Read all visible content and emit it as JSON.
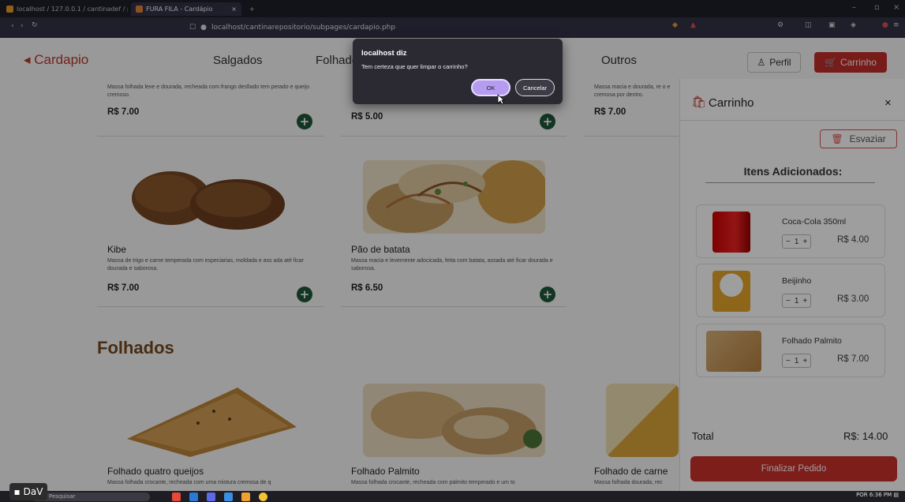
{
  "browser": {
    "tabs": [
      {
        "label": "localhost / 127.0.0.1 / cantinadef / p"
      },
      {
        "label": "FURA FILA - Cardápio"
      }
    ],
    "new_tab": "+",
    "url": "localhost/cantinarepositorio/subpages/cardapio.php"
  },
  "nav": {
    "brand": "Cardapio",
    "links": [
      "Salgados",
      "Folhados",
      "Outros"
    ],
    "perfil": "Perfil",
    "carrinho": "Carrinho"
  },
  "products_top": [
    {
      "desc": "Massa folhada leve e dourada, recheada com frango desfiado tem perado e queijo cremoso.",
      "price": "R$ 7.00"
    },
    {
      "desc": "",
      "price": "R$ 5.00"
    },
    {
      "desc": "Massa macia e dourada, re o e cremosa por dentro.",
      "price": "R$ 7.00"
    }
  ],
  "products_mid": [
    {
      "name": "Kibe",
      "desc": "Massa de trigo e carne temperada com especiarias, moldada e ass ada até ficar dourada e saborosa.",
      "price": "R$ 7.00"
    },
    {
      "name": "Pão de batata",
      "desc": "Massa macia e levemente adocicada, feita com batata, assada até ficar dourada e saborosa.",
      "price": "R$ 6.50"
    }
  ],
  "section_folhados": "Folhados",
  "products_bottom": [
    {
      "name": "Folhado quatro queijos",
      "desc": "Massa folhada crocante, recheada com uma mistura cremosa de q"
    },
    {
      "name": "Folhado Palmito",
      "desc": "Massa folhada crocante, recheada com palmito temperado e um to"
    },
    {
      "name": "Folhado de carne",
      "desc": "Massa folhada dourada, rec"
    }
  ],
  "cart": {
    "title": "Carrinho",
    "close": "×",
    "esvaziar": "Esvaziar",
    "itens_title": "Itens Adicionados:",
    "items": [
      {
        "name": "Coca-Cola 350ml",
        "qty": "1",
        "price": "R$ 4.00"
      },
      {
        "name": "Beijinho",
        "qty": "1",
        "price": "R$ 3.00"
      },
      {
        "name": "Folhado Palmito",
        "qty": "1",
        "price": "R$ 7.00"
      }
    ],
    "total_label": "Total",
    "total_value": "R$: 14.00",
    "finalizar": "Finalizar Pedido"
  },
  "dialog": {
    "title": "localhost diz",
    "message": "Tem certeza que quer limpar o carrinho?",
    "ok": "OK",
    "cancel": "Cancelar"
  },
  "taskbar": {
    "search": "Pesquisar",
    "lang": "POR",
    "time": "6:36 PM"
  },
  "dav": "DaV",
  "colors": {
    "accent": "#c9302c",
    "green": "#1e5a3a",
    "section": "#7a4a20"
  }
}
